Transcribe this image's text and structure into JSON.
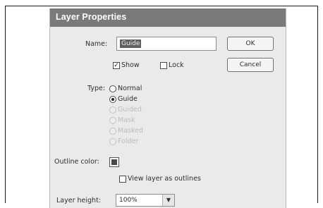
{
  "dialog": {
    "title": "Layer Properties",
    "name_label": "Name:",
    "name_value": "Guide",
    "ok_label": "OK",
    "cancel_label": "Cancel",
    "show_label": "Show",
    "show_checked": true,
    "lock_label": "Lock",
    "lock_checked": false,
    "type_label": "Type:",
    "types": [
      {
        "label": "Normal",
        "selected": false,
        "enabled": true
      },
      {
        "label": "Guide",
        "selected": true,
        "enabled": true
      },
      {
        "label": "Guided",
        "selected": false,
        "enabled": false
      },
      {
        "label": "Mask",
        "selected": false,
        "enabled": false
      },
      {
        "label": "Masked",
        "selected": false,
        "enabled": false
      },
      {
        "label": "Folder",
        "selected": false,
        "enabled": false
      }
    ],
    "outline_color_label": "Outline color:",
    "view_outlines_label": "View layer as outlines",
    "view_outlines_checked": false,
    "layer_height_label": "Layer height:",
    "layer_height_value": "100%",
    "dropdown_icon": "chevron-down-icon",
    "check_icon": "checkmark-icon"
  }
}
